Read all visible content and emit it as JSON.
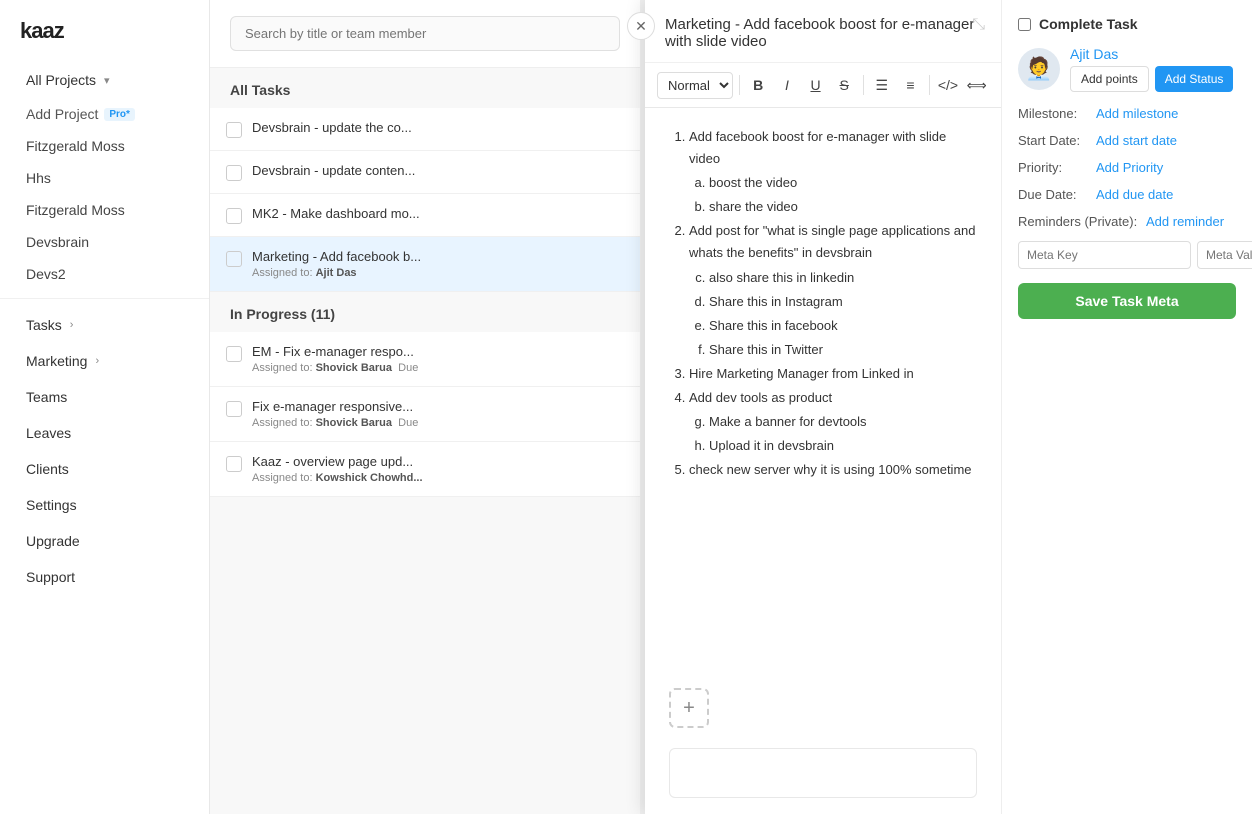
{
  "app": {
    "logo": "kaaz",
    "profile_icon": "👤"
  },
  "sidebar": {
    "all_projects_label": "All Projects",
    "add_project_label": "Add Project",
    "pro_badge": "Pro*",
    "projects": [
      {
        "name": "Fitzgerald Moss"
      },
      {
        "name": "Hhs"
      },
      {
        "name": "Fitzgerald Moss"
      },
      {
        "name": "Devsbrain"
      },
      {
        "name": "Devs2"
      }
    ],
    "nav_items": [
      {
        "label": "Tasks",
        "has_arrow": true
      },
      {
        "label": "Marketing",
        "has_arrow": true
      },
      {
        "label": "Teams"
      },
      {
        "label": "Leaves"
      },
      {
        "label": "Clients"
      },
      {
        "label": "Settings"
      },
      {
        "label": "Upgrade"
      },
      {
        "label": "Support"
      }
    ]
  },
  "task_list": {
    "search_placeholder": "Search by title or team member",
    "all_tasks_label": "All Tasks",
    "in_progress_label": "In Progress (11)",
    "tasks": [
      {
        "title": "Devsbrain - update the co...",
        "assigned_to": null,
        "due": null
      },
      {
        "title": "Devsbrain - update conten...",
        "assigned_to": null,
        "due": null
      },
      {
        "title": "MK2 - Make dashboard mo...",
        "assigned_to": null,
        "due": null
      },
      {
        "title": "Marketing - Add facebook b...",
        "assigned_to": "Ajit Das",
        "due": null,
        "selected": true
      }
    ],
    "in_progress_tasks": [
      {
        "title": "EM - Fix e-manager respo...",
        "assigned_to": "Shovick Barua",
        "due": "Due"
      },
      {
        "title": "Fix e-manager responsive...",
        "assigned_to": "Shovick Barua",
        "due": "Due"
      },
      {
        "title": "Kaaz - overview page upd...",
        "assigned_to": "Kowshick Chowhd...",
        "due": null
      }
    ]
  },
  "modal": {
    "title": "Marketing - Add facebook boost for e-manager with slide video",
    "editor": {
      "style_label": "Normal",
      "content_items": [
        "Add facebook boost for e-manager with slide video",
        "boost the video",
        "share the video",
        "Add post for \"what is single page applications and whats the benefits\" in devsbrain",
        "also share this in linkedin",
        "Share this in Instagram",
        "Share this in facebook",
        "Share this in Twitter",
        "Hire Marketing Manager from Linked in",
        "Add dev tools as product",
        "Make a banner for devtools",
        "Upload it in devsbrain",
        "check new server why it is using 100% sometime"
      ]
    },
    "sidebar": {
      "complete_task_label": "Complete Task",
      "assignee_name": "Ajit Das",
      "add_points_label": "Add points",
      "add_status_label": "Add Status",
      "milestone_label": "Milestone:",
      "milestone_value": "Add milestone",
      "start_date_label": "Start Date:",
      "start_date_value": "Add start date",
      "priority_label": "Priority:",
      "priority_value": "Add Priority",
      "due_date_label": "Due Date:",
      "due_date_value": "Add due date",
      "reminders_label": "Reminders (Private):",
      "reminders_value": "Add reminder",
      "meta_key_placeholder": "Meta Key",
      "meta_value_placeholder": "Meta Valu...",
      "save_meta_label": "Save Task Meta",
      "add_meta_icon": "+"
    }
  }
}
